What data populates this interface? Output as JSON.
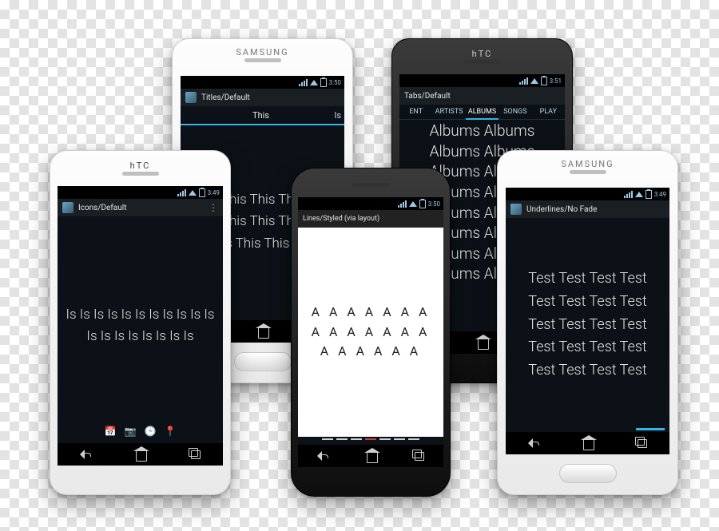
{
  "brands": {
    "samsung": "SAMSUNG",
    "htc": "hTC"
  },
  "clock": {
    "t349": "3:49",
    "t350": "3:50",
    "t351": "3:51"
  },
  "phones": {
    "titles": {
      "actionbar": "Titles/Default",
      "tab_main": "This",
      "tab_side": "Is",
      "body": "This This This This This This This This This This This This This This"
    },
    "tabs": {
      "actionbar": "Tabs/Default",
      "tab_ent": "ENT",
      "tab_artists": "ARTISTS",
      "tab_albums": "ALBUMS",
      "tab_songs": "SONGS",
      "tab_play": "PLAY",
      "body": "Albums Albums Albums Albums Albums Albums Albums Albums Albums Albums Albums Albums Albums Albums Albums Albums"
    },
    "icons": {
      "actionbar": "Icons/Default",
      "body": "Is Is Is Is Is Is Is Is Is Is Is Is Is Is Is Is Is Is Is",
      "row": {
        "cal": "📅",
        "cam": "📷",
        "clk": "🕒",
        "pin": "📍"
      }
    },
    "lines": {
      "actionbar": "Lines/Styled (via layout)",
      "body": "A A A A A A A A A A A A A A A A A A A A"
    },
    "underlines": {
      "actionbar": "Underlines/No Fade",
      "body": "Test Test Test Test Test Test Test Test Test Test Test Test Test Test Test Test Test Test Test Test"
    }
  }
}
